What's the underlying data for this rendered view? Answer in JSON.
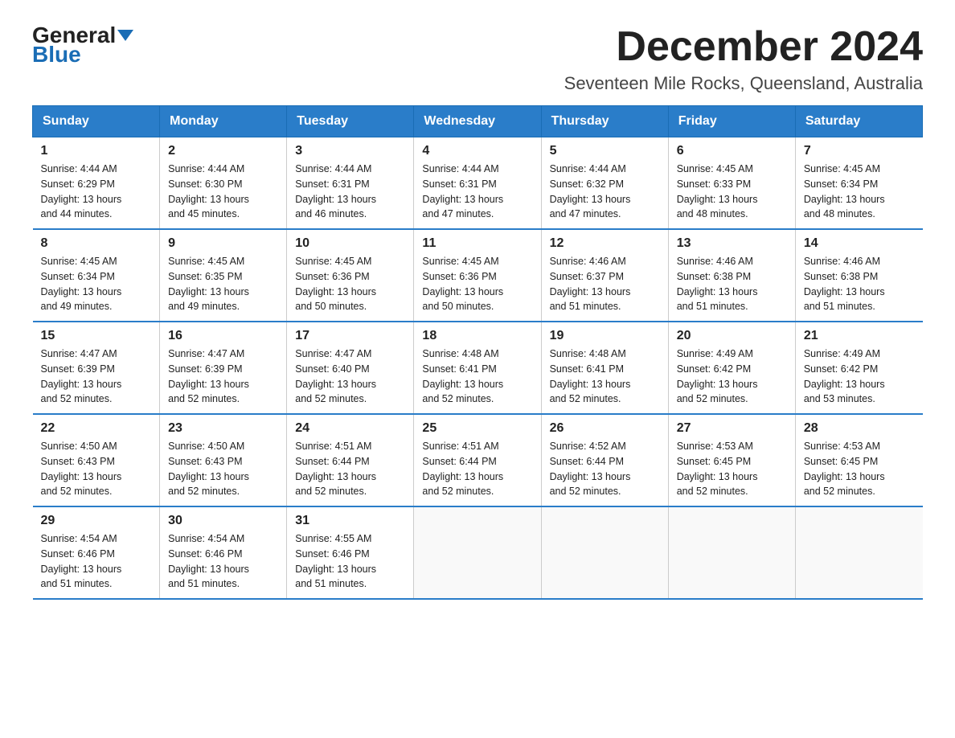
{
  "header": {
    "logo_general": "General",
    "logo_blue": "Blue",
    "month_title": "December 2024",
    "location": "Seventeen Mile Rocks, Queensland, Australia"
  },
  "days_of_week": [
    "Sunday",
    "Monday",
    "Tuesday",
    "Wednesday",
    "Thursday",
    "Friday",
    "Saturday"
  ],
  "weeks": [
    [
      {
        "day": "1",
        "sunrise": "4:44 AM",
        "sunset": "6:29 PM",
        "daylight": "13 hours and 44 minutes."
      },
      {
        "day": "2",
        "sunrise": "4:44 AM",
        "sunset": "6:30 PM",
        "daylight": "13 hours and 45 minutes."
      },
      {
        "day": "3",
        "sunrise": "4:44 AM",
        "sunset": "6:31 PM",
        "daylight": "13 hours and 46 minutes."
      },
      {
        "day": "4",
        "sunrise": "4:44 AM",
        "sunset": "6:31 PM",
        "daylight": "13 hours and 47 minutes."
      },
      {
        "day": "5",
        "sunrise": "4:44 AM",
        "sunset": "6:32 PM",
        "daylight": "13 hours and 47 minutes."
      },
      {
        "day": "6",
        "sunrise": "4:45 AM",
        "sunset": "6:33 PM",
        "daylight": "13 hours and 48 minutes."
      },
      {
        "day": "7",
        "sunrise": "4:45 AM",
        "sunset": "6:34 PM",
        "daylight": "13 hours and 48 minutes."
      }
    ],
    [
      {
        "day": "8",
        "sunrise": "4:45 AM",
        "sunset": "6:34 PM",
        "daylight": "13 hours and 49 minutes."
      },
      {
        "day": "9",
        "sunrise": "4:45 AM",
        "sunset": "6:35 PM",
        "daylight": "13 hours and 49 minutes."
      },
      {
        "day": "10",
        "sunrise": "4:45 AM",
        "sunset": "6:36 PM",
        "daylight": "13 hours and 50 minutes."
      },
      {
        "day": "11",
        "sunrise": "4:45 AM",
        "sunset": "6:36 PM",
        "daylight": "13 hours and 50 minutes."
      },
      {
        "day": "12",
        "sunrise": "4:46 AM",
        "sunset": "6:37 PM",
        "daylight": "13 hours and 51 minutes."
      },
      {
        "day": "13",
        "sunrise": "4:46 AM",
        "sunset": "6:38 PM",
        "daylight": "13 hours and 51 minutes."
      },
      {
        "day": "14",
        "sunrise": "4:46 AM",
        "sunset": "6:38 PM",
        "daylight": "13 hours and 51 minutes."
      }
    ],
    [
      {
        "day": "15",
        "sunrise": "4:47 AM",
        "sunset": "6:39 PM",
        "daylight": "13 hours and 52 minutes."
      },
      {
        "day": "16",
        "sunrise": "4:47 AM",
        "sunset": "6:39 PM",
        "daylight": "13 hours and 52 minutes."
      },
      {
        "day": "17",
        "sunrise": "4:47 AM",
        "sunset": "6:40 PM",
        "daylight": "13 hours and 52 minutes."
      },
      {
        "day": "18",
        "sunrise": "4:48 AM",
        "sunset": "6:41 PM",
        "daylight": "13 hours and 52 minutes."
      },
      {
        "day": "19",
        "sunrise": "4:48 AM",
        "sunset": "6:41 PM",
        "daylight": "13 hours and 52 minutes."
      },
      {
        "day": "20",
        "sunrise": "4:49 AM",
        "sunset": "6:42 PM",
        "daylight": "13 hours and 52 minutes."
      },
      {
        "day": "21",
        "sunrise": "4:49 AM",
        "sunset": "6:42 PM",
        "daylight": "13 hours and 53 minutes."
      }
    ],
    [
      {
        "day": "22",
        "sunrise": "4:50 AM",
        "sunset": "6:43 PM",
        "daylight": "13 hours and 52 minutes."
      },
      {
        "day": "23",
        "sunrise": "4:50 AM",
        "sunset": "6:43 PM",
        "daylight": "13 hours and 52 minutes."
      },
      {
        "day": "24",
        "sunrise": "4:51 AM",
        "sunset": "6:44 PM",
        "daylight": "13 hours and 52 minutes."
      },
      {
        "day": "25",
        "sunrise": "4:51 AM",
        "sunset": "6:44 PM",
        "daylight": "13 hours and 52 minutes."
      },
      {
        "day": "26",
        "sunrise": "4:52 AM",
        "sunset": "6:44 PM",
        "daylight": "13 hours and 52 minutes."
      },
      {
        "day": "27",
        "sunrise": "4:53 AM",
        "sunset": "6:45 PM",
        "daylight": "13 hours and 52 minutes."
      },
      {
        "day": "28",
        "sunrise": "4:53 AM",
        "sunset": "6:45 PM",
        "daylight": "13 hours and 52 minutes."
      }
    ],
    [
      {
        "day": "29",
        "sunrise": "4:54 AM",
        "sunset": "6:46 PM",
        "daylight": "13 hours and 51 minutes."
      },
      {
        "day": "30",
        "sunrise": "4:54 AM",
        "sunset": "6:46 PM",
        "daylight": "13 hours and 51 minutes."
      },
      {
        "day": "31",
        "sunrise": "4:55 AM",
        "sunset": "6:46 PM",
        "daylight": "13 hours and 51 minutes."
      },
      null,
      null,
      null,
      null
    ]
  ],
  "labels": {
    "sunrise_prefix": "Sunrise: ",
    "sunset_prefix": "Sunset: ",
    "daylight_prefix": "Daylight: "
  }
}
